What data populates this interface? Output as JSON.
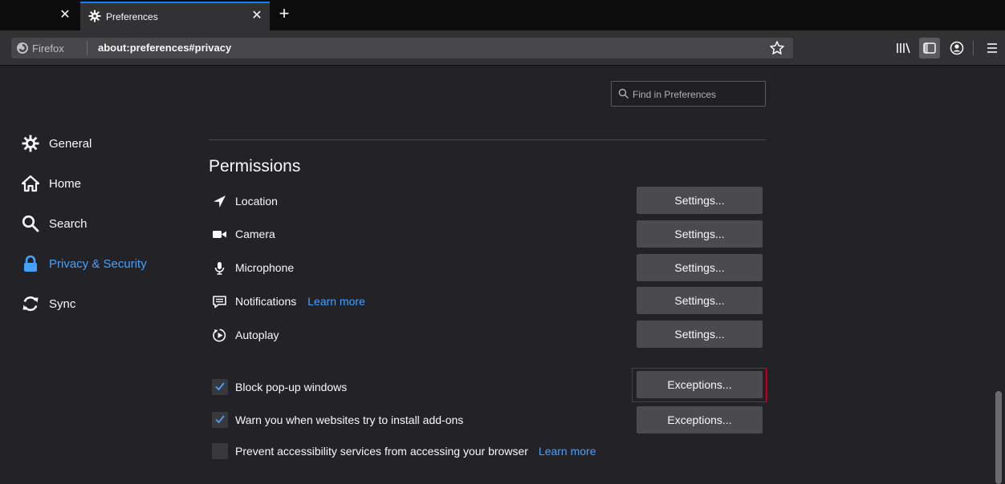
{
  "browser": {
    "tab_title": "Preferences",
    "tab_close_glyph": "✕",
    "prev_tab_close_glyph": "✕",
    "new_tab_glyph": "+",
    "identity_label": "Firefox",
    "url": "about:preferences#privacy"
  },
  "search": {
    "placeholder": "Find in Preferences"
  },
  "sidebar": {
    "items": [
      {
        "label": "General",
        "icon": "gear-icon",
        "selected": false
      },
      {
        "label": "Home",
        "icon": "home-icon",
        "selected": false
      },
      {
        "label": "Search",
        "icon": "search-icon",
        "selected": false
      },
      {
        "label": "Privacy & Security",
        "icon": "lock-icon",
        "selected": true
      },
      {
        "label": "Sync",
        "icon": "sync-icon",
        "selected": false
      }
    ]
  },
  "permissions": {
    "title": "Permissions",
    "rows": [
      {
        "label": "Location",
        "icon": "location-arrow-icon",
        "button": "Settings..."
      },
      {
        "label": "Camera",
        "icon": "camera-icon",
        "button": "Settings..."
      },
      {
        "label": "Microphone",
        "icon": "microphone-icon",
        "button": "Settings..."
      },
      {
        "label": "Notifications",
        "icon": "notification-icon",
        "learn_more": "Learn more",
        "button": "Settings..."
      },
      {
        "label": "Autoplay",
        "icon": "autoplay-icon",
        "button": "Settings..."
      }
    ],
    "checks": [
      {
        "label": "Block pop-up windows",
        "checked": true,
        "button": "Exceptions..."
      },
      {
        "label": "Warn you when websites try to install add-ons",
        "checked": true,
        "button": "Exceptions..."
      },
      {
        "label": "Prevent accessibility services from accessing your browser",
        "checked": false,
        "learn_more": "Learn more"
      }
    ]
  },
  "colors": {
    "accent": "#45a1ff",
    "tab_highlight": "#0a84ff",
    "focus_outline": "#d70022",
    "background": "#232327"
  }
}
